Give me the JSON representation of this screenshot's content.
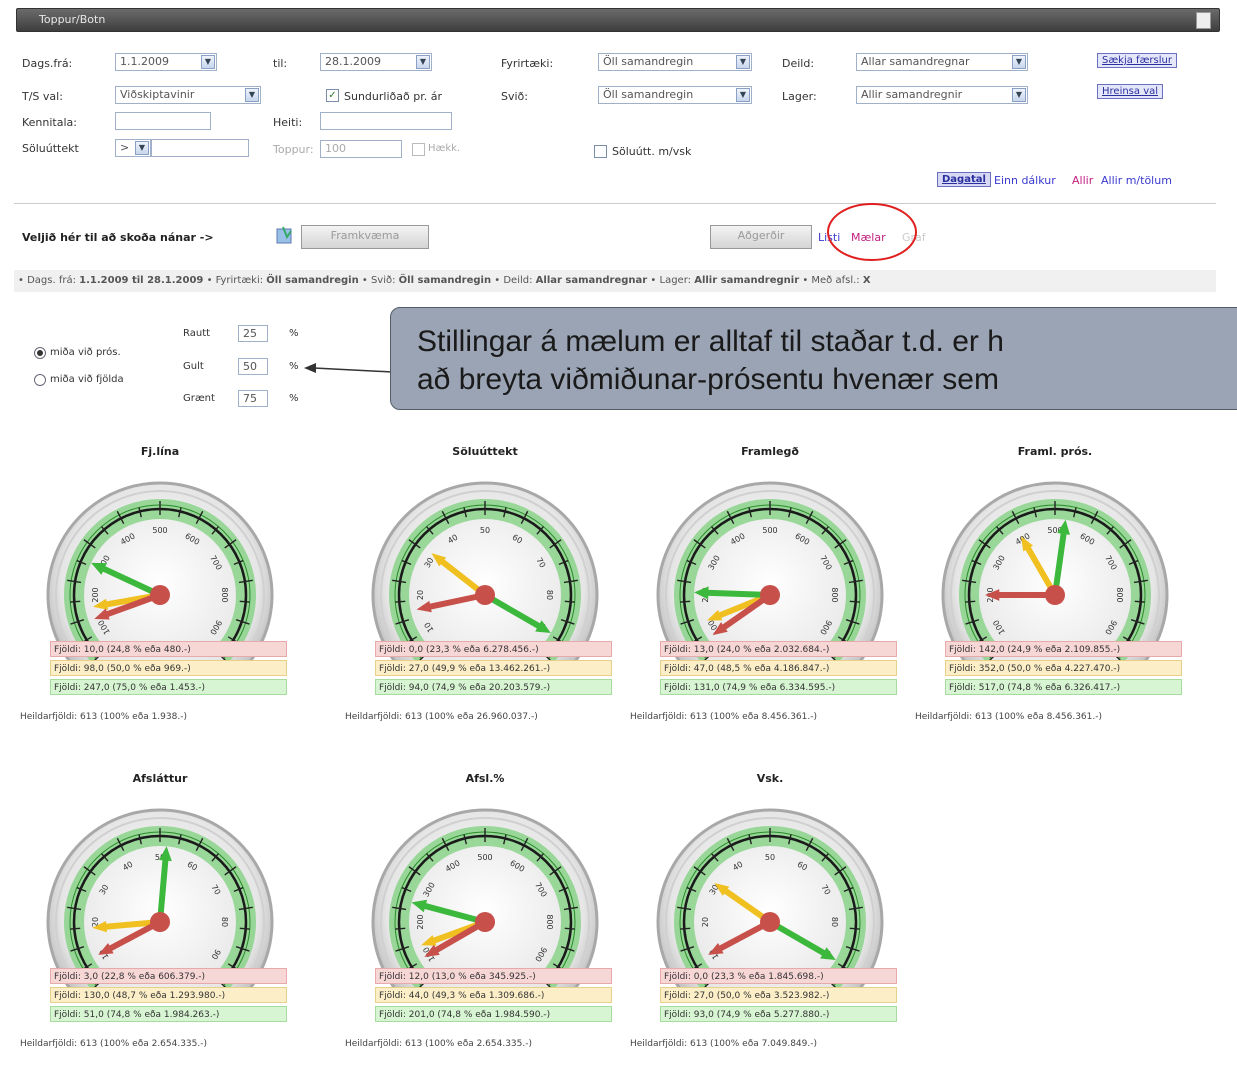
{
  "window": {
    "title": "Toppur/Botn"
  },
  "filters": {
    "dags_fra_label": "Dags.frá:",
    "dags_fra_value": "1.1.2009",
    "til_label": "til:",
    "til_value": "28.1.2009",
    "fyrirtaeki_label": "Fyrirtæki:",
    "fyrirtaeki_value": "Öll samandregin",
    "deild_label": "Deild:",
    "deild_value": "Allar samandregnar",
    "saekja_button": "Sækja færslur",
    "ts_label": "T/S val:",
    "ts_value": "Viðskiptavinir",
    "sundurlidad_label": "Sundurliðað pr. ár",
    "svid_label": "Svið:",
    "svid_value": "Öll samandregin",
    "lager_label": "Lager:",
    "lager_value": "Allir samandregnir",
    "hreinsa_button": "Hreinsa val",
    "kennitala_label": "Kennitala:",
    "heiti_label": "Heiti:",
    "soluuttekt_label": "Söluúttekt",
    "soluuttekt_value": ">",
    "toppur_label": "Toppur:",
    "toppur_value": "100",
    "haekk_label": "Hækk.",
    "soluutt_vsk_label": "Söluútt. m/vsk",
    "dagatal_button": "Dagatal",
    "einn_dalkur_link": "Einn dálkur",
    "allir_link": "Allir",
    "allir_tolum_link": "Allir m/tölum"
  },
  "actions": {
    "veljid_label": "Veljið hér til að skoða nánar ->",
    "framkvaema_button": "Framkvæma",
    "aegerdir_button": "Aðgerðir",
    "listi_link": "Listi",
    "maelar_link": "Mælar",
    "graf_link": "Graf"
  },
  "infobar": {
    "text_prefix": "• Dags. frá:",
    "date_range": "1.1.2009 til 28.1.2009",
    "fyrirtaeki_lbl": "• Fyrirtæki:",
    "fyrirtaeki_val": "Öll samandregin",
    "svid_lbl": "• Svið:",
    "svid_val": "Öll samandregin",
    "deild_lbl": "• Deild:",
    "deild_val": "Allar samandregnar",
    "lager_lbl": "• Lager:",
    "lager_val": "Allir samandregnir",
    "afsl_lbl": "• Með afsl.:",
    "afsl_val": "X"
  },
  "settings": {
    "midad_pros": "miða við prós.",
    "midad_fjolda": "miða við fjölda",
    "rautt_label": "Rautt",
    "rautt_value": "25",
    "gult_label": "Gult",
    "gult_value": "50",
    "graent_label": "Grænt",
    "graent_value": "75",
    "pct_sign": "%"
  },
  "callout": {
    "line1": "Stillingar á mælum er alltaf til staðar t.d. er h",
    "line2": "að breyta viðmiðunar-prósentu hvenær sem"
  },
  "colors": {
    "red": "#c8504a",
    "yellow": "#f0c020",
    "green": "#3cb83c",
    "band": "#7cd07c"
  },
  "gauges": [
    {
      "title": "Fj.lína",
      "red_angle": -110,
      "yellow_angle": -100,
      "green_angle": -65,
      "r": "Fjöldi: 10,0 (24,8 % eða 480.-)",
      "y": "Fjöldi: 98,0 (50,0 % eða 969.-)",
      "g": "Fjöldi: 247,0 (75,0 % eða 1.453.-)",
      "total": "Heildarfjöldi: 613 (100% eða 1.938.-)",
      "ticks": [
        "100",
        "200",
        "300",
        "400",
        "500",
        "600",
        "700",
        "800",
        "900"
      ]
    },
    {
      "title": "Söluúttekt",
      "red_angle": -102,
      "yellow_angle": -52,
      "green_angle": 120,
      "r": "Fjöldi: 0,0 (23,3 % eða 6.278.456.-)",
      "y": "Fjöldi: 27,0 (49,9 % eða 13.462.261.-)",
      "g": "Fjöldi: 94,0 (74,9 % eða 20.203.579.-)",
      "total": "Heildarfjöldi: 613 (100% eða 26.960.037.-)",
      "ticks": [
        "10",
        "20",
        "30",
        "40",
        "50",
        "60",
        "70",
        "80",
        "90"
      ]
    },
    {
      "title": "Framlegð",
      "red_angle": -125,
      "yellow_angle": -112,
      "green_angle": -88,
      "r": "Fjöldi: 13,0 (24,0 % eða 2.032.684.-)",
      "y": "Fjöldi: 47,0 (48,5 % eða 4.186.847.-)",
      "g": "Fjöldi: 131,0 (74,9 % eða 6.334.595.-)",
      "total": "Heildarfjöldi: 613 (100% eða 8.456.361.-)",
      "ticks": [
        "100",
        "200",
        "300",
        "400",
        "500",
        "600",
        "700",
        "800",
        "900"
      ]
    },
    {
      "title": "Framl. prós.",
      "red_angle": -90,
      "yellow_angle": -30,
      "green_angle": 8,
      "r": "Fjöldi: 142,0 (24,9 % eða 2.109.855.-)",
      "y": "Fjöldi: 352,0 (50,0 % eða 4.227.470.-)",
      "g": "Fjöldi: 517,0 (74,8 % eða 6.326.417.-)",
      "total": "Heildarfjöldi: 613 (100% eða 8.456.361.-)",
      "ticks": [
        "100",
        "200",
        "300",
        "400",
        "500",
        "600",
        "700",
        "800",
        "900"
      ]
    },
    {
      "title": "Afsláttur",
      "red_angle": -118,
      "yellow_angle": -95,
      "green_angle": 5,
      "r": "Fjöldi: 3,0 (22,8 % eða 606.379.-)",
      "y": "Fjöldi: 130,0 (48,7 % eða 1.293.980.-)",
      "g": "Fjöldi: 51,0 (74,8 % eða 1.984.263.-)",
      "total": "Heildarfjöldi: 613 (100% eða 2.654.335.-)",
      "ticks": [
        "10",
        "20",
        "30",
        "40",
        "50",
        "60",
        "70",
        "80",
        "90"
      ]
    },
    {
      "title": "Afsl.%",
      "red_angle": -120,
      "yellow_angle": -110,
      "green_angle": -75,
      "r": "Fjöldi: 12,0 (13,0 % eða 345.925.-)",
      "y": "Fjöldi: 44,0 (49,3 % eða 1.309.686.-)",
      "g": "Fjöldi: 201,0 (74,8 % eða 1.984.590.-)",
      "total": "Heildarfjöldi: 613 (100% eða 2.654.335.-)",
      "ticks": [
        "100",
        "200",
        "300",
        "400",
        "500",
        "600",
        "700",
        "800",
        "900"
      ]
    },
    {
      "title": "Vsk.",
      "red_angle": -118,
      "yellow_angle": -55,
      "green_angle": 120,
      "r": "Fjöldi: 0,0 (23,3 % eða 1.845.698.-)",
      "y": "Fjöldi: 27,0 (50,0 % eða 3.523.982.-)",
      "g": "Fjöldi: 93,0 (74,9 % eða 5.277.880.-)",
      "total": "Heildarfjöldi: 613 (100% eða 7.049.849.-)",
      "ticks": [
        "10",
        "20",
        "30",
        "40",
        "50",
        "60",
        "70",
        "80",
        "90"
      ]
    }
  ]
}
